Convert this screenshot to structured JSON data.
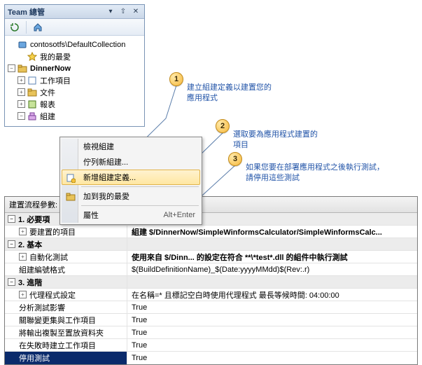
{
  "panel": {
    "title": "Team 總管",
    "toolbar": {
      "refresh": "refresh",
      "home": "home",
      "connect": "connect"
    },
    "tree": {
      "collection": "contosotfs\\DefaultCollection",
      "project": "DinnerNow",
      "nodes": {
        "fav": "我的最愛",
        "workitems": "工作項目",
        "documents": "文件",
        "reports": "報表",
        "builds": "組建"
      }
    }
  },
  "context_menu": {
    "view_builds": "檢視組建",
    "queue_new_build": "佇列新組建...",
    "new_build_def": "新增組建定義...",
    "add_to_favorites": "加到我的最愛",
    "properties": "屬性",
    "properties_short": "Alt+Enter"
  },
  "callouts": {
    "c1": {
      "n": "1",
      "l1": "建立組建定義以建置您的",
      "l2": "應用程式"
    },
    "c2": {
      "n": "2",
      "l1": "選取要為應用程式建置的",
      "l2": "項目"
    },
    "c3": {
      "n": "3",
      "l1": "如果您要在部署應用程式之後執行測試，",
      "l2": "請停用這些測試"
    }
  },
  "grid": {
    "title": "建置流程參數:",
    "sec1": "1. 必要項",
    "sec2": "2. 基本",
    "sec3": "3. 進階",
    "rows": {
      "items_to_build": {
        "label": "要建置的項目",
        "value": "組建 $/DinnerNow/SimpleWinformsCalculator/SimpleWinformsCalc..."
      },
      "automated_tests": {
        "label": "自動化測試",
        "value": "使用來自 $/Dinn... 的設定在符合 **\\*test*.dll 的組件中執行測試"
      },
      "build_number_format": {
        "label": "組建編號格式",
        "value": "$(BuildDefinitionName)_$(Date:yyyyMMdd)$(Rev:.r)"
      },
      "agent_settings": {
        "label": "代理程式設定",
        "value": "在名稱=* 且標記空白時使用代理程式 最長等候時間: 04:00:00"
      },
      "analyze_test_impact": {
        "label": "分析測試影響",
        "value": "True"
      },
      "associate_changesets": {
        "label": "關聯變更集與工作項目",
        "value": "True"
      },
      "copy_outputs": {
        "label": "將輸出複製至置放資料夾",
        "value": "True"
      },
      "create_wi_on_fail": {
        "label": "在失敗時建立工作項目",
        "value": "True"
      },
      "disable_tests": {
        "label": "停用測試",
        "value": "True"
      }
    }
  }
}
